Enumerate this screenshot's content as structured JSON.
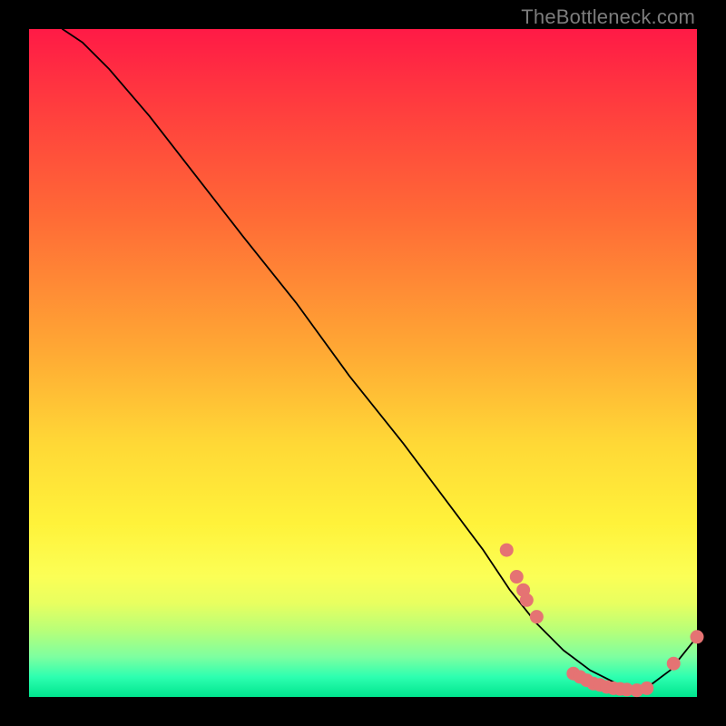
{
  "watermark": "TheBottleneck.com",
  "chart_data": {
    "type": "line",
    "title": "",
    "xlabel": "",
    "ylabel": "",
    "xlim": [
      0,
      100
    ],
    "ylim": [
      0,
      100
    ],
    "grid": false,
    "curve": {
      "x": [
        5,
        8,
        12,
        18,
        25,
        32,
        40,
        48,
        56,
        62,
        68,
        72,
        76,
        80,
        84,
        88,
        92,
        96,
        100
      ],
      "y": [
        100,
        98,
        94,
        87,
        78,
        69,
        59,
        48,
        38,
        30,
        22,
        16,
        11,
        7,
        4,
        2,
        1,
        4,
        9
      ]
    },
    "points": {
      "name": "markers",
      "color_hex": "#e57373",
      "coords": [
        {
          "x": 71.5,
          "y": 22.0
        },
        {
          "x": 73.0,
          "y": 18.0
        },
        {
          "x": 74.0,
          "y": 16.0
        },
        {
          "x": 74.5,
          "y": 14.5
        },
        {
          "x": 76.0,
          "y": 12.0
        },
        {
          "x": 81.5,
          "y": 3.5
        },
        {
          "x": 82.5,
          "y": 3.0
        },
        {
          "x": 83.5,
          "y": 2.5
        },
        {
          "x": 84.5,
          "y": 2.0
        },
        {
          "x": 85.5,
          "y": 1.8
        },
        {
          "x": 86.5,
          "y": 1.5
        },
        {
          "x": 87.5,
          "y": 1.3
        },
        {
          "x": 88.5,
          "y": 1.2
        },
        {
          "x": 89.5,
          "y": 1.1
        },
        {
          "x": 91.0,
          "y": 1.0
        },
        {
          "x": 92.5,
          "y": 1.3
        },
        {
          "x": 96.5,
          "y": 5.0
        },
        {
          "x": 100.0,
          "y": 9.0
        }
      ]
    }
  }
}
